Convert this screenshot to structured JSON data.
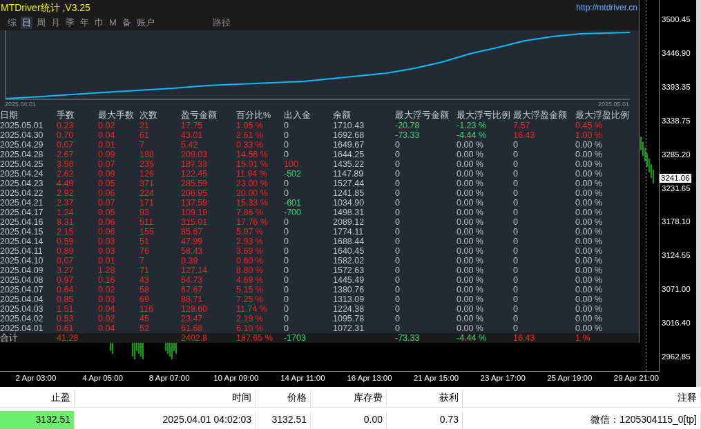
{
  "title": "MTDriver统计 ,V3.25",
  "url": "http://mtdriver.cn",
  "tabs": [
    {
      "label": "综",
      "selected": false
    },
    {
      "label": "日",
      "selected": true
    },
    {
      "label": "周",
      "selected": false
    },
    {
      "label": "月",
      "selected": false
    },
    {
      "label": "季",
      "selected": false
    },
    {
      "label": "年",
      "selected": false
    },
    {
      "label": "巾",
      "selected": false
    },
    {
      "label": "M",
      "selected": false
    },
    {
      "label": "备",
      "selected": false
    },
    {
      "label": "账户",
      "selected": false
    },
    {
      "label": "路径",
      "selected": false
    }
  ],
  "equity_chart": {
    "start_date": "2025.04.01",
    "end_date": "2025.05.01"
  },
  "stats_table": {
    "columns": [
      "日期",
      "手数",
      "最大手数",
      "次数",
      "盈亏金额",
      "百分比%",
      "出入金",
      "余额",
      "最大浮亏金额",
      "最大浮亏比例",
      "最大浮盈金额",
      "最大浮盈比例"
    ],
    "rows": [
      [
        {
          "text": "2025.05.01",
          "color": "#c0c4cc"
        },
        {
          "text": "0.23",
          "color": "#ff2020"
        },
        {
          "text": "0.02",
          "color": "#ff2020"
        },
        {
          "text": "21",
          "color": "#ff2020"
        },
        {
          "text": "17.75",
          "color": "#ff2020"
        },
        {
          "text": "1.05 %",
          "color": "#ff2020"
        },
        {
          "text": "0",
          "color": "#c0c4cc"
        },
        {
          "text": "1710.43",
          "color": "#c0c4cc"
        },
        {
          "text": "-20.78",
          "color": "#20e070"
        },
        {
          "text": "-1.23 %",
          "color": "#20e070"
        },
        {
          "text": "7.57",
          "color": "#ff2020"
        },
        {
          "text": "0.45 %",
          "color": "#ff2020"
        }
      ],
      [
        {
          "text": "2025.04.30",
          "color": "#c0c4cc"
        },
        {
          "text": "0.70",
          "color": "#ff2020"
        },
        {
          "text": "0.04",
          "color": "#ff2020"
        },
        {
          "text": "61",
          "color": "#ff2020"
        },
        {
          "text": "43.01",
          "color": "#ff2020"
        },
        {
          "text": "2.61 %",
          "color": "#ff2020"
        },
        {
          "text": "0",
          "color": "#c0c4cc"
        },
        {
          "text": "1692.68",
          "color": "#c0c4cc"
        },
        {
          "text": "-73.33",
          "color": "#20e070"
        },
        {
          "text": "-4.44 %",
          "color": "#20e070"
        },
        {
          "text": "16.43",
          "color": "#ff2020"
        },
        {
          "text": "1.00 %",
          "color": "#ff2020"
        }
      ],
      [
        {
          "text": "2025.04.29",
          "color": "#c0c4cc"
        },
        {
          "text": "0.07",
          "color": "#ff2020"
        },
        {
          "text": "0.01",
          "color": "#ff2020"
        },
        {
          "text": "7",
          "color": "#ff2020"
        },
        {
          "text": "5.42",
          "color": "#ff2020"
        },
        {
          "text": "0.33 %",
          "color": "#ff2020"
        },
        {
          "text": "0",
          "color": "#c0c4cc"
        },
        {
          "text": "1649.67",
          "color": "#c0c4cc"
        },
        {
          "text": "0",
          "color": "#c0c4cc"
        },
        {
          "text": "0.00 %",
          "color": "#c0c4cc"
        },
        {
          "text": "0",
          "color": "#c0c4cc"
        },
        {
          "text": "0.00 %",
          "color": "#c0c4cc"
        }
      ],
      [
        {
          "text": "2025.04.28",
          "color": "#c0c4cc"
        },
        {
          "text": "2.67",
          "color": "#ff2020"
        },
        {
          "text": "0.09",
          "color": "#ff2020"
        },
        {
          "text": "188",
          "color": "#ff2020"
        },
        {
          "text": "209.03",
          "color": "#ff2020"
        },
        {
          "text": "14.56 %",
          "color": "#ff2020"
        },
        {
          "text": "0",
          "color": "#c0c4cc"
        },
        {
          "text": "1644.25",
          "color": "#c0c4cc"
        },
        {
          "text": "0",
          "color": "#c0c4cc"
        },
        {
          "text": "0.00 %",
          "color": "#c0c4cc"
        },
        {
          "text": "0",
          "color": "#c0c4cc"
        },
        {
          "text": "0.00 %",
          "color": "#c0c4cc"
        }
      ],
      [
        {
          "text": "2025.04.25",
          "color": "#c0c4cc"
        },
        {
          "text": "3.58",
          "color": "#ff2020"
        },
        {
          "text": "0.07",
          "color": "#ff2020"
        },
        {
          "text": "235",
          "color": "#ff2020"
        },
        {
          "text": "187.33",
          "color": "#ff2020"
        },
        {
          "text": "15.01 %",
          "color": "#ff2020"
        },
        {
          "text": "100",
          "color": "#ff2020"
        },
        {
          "text": "1435.22",
          "color": "#c0c4cc"
        },
        {
          "text": "0",
          "color": "#c0c4cc"
        },
        {
          "text": "0.00 %",
          "color": "#c0c4cc"
        },
        {
          "text": "0",
          "color": "#c0c4cc"
        },
        {
          "text": "0.00 %",
          "color": "#c0c4cc"
        }
      ],
      [
        {
          "text": "2025.04.24",
          "color": "#c0c4cc"
        },
        {
          "text": "2.62",
          "color": "#ff2020"
        },
        {
          "text": "0.09",
          "color": "#ff2020"
        },
        {
          "text": "126",
          "color": "#ff2020"
        },
        {
          "text": "122.45",
          "color": "#ff2020"
        },
        {
          "text": "11.94 %",
          "color": "#ff2020"
        },
        {
          "text": "-502",
          "color": "#20e070"
        },
        {
          "text": "1147.89",
          "color": "#c0c4cc"
        },
        {
          "text": "0",
          "color": "#c0c4cc"
        },
        {
          "text": "0.00 %",
          "color": "#c0c4cc"
        },
        {
          "text": "0",
          "color": "#c0c4cc"
        },
        {
          "text": "0.00 %",
          "color": "#c0c4cc"
        }
      ],
      [
        {
          "text": "2025.04.23",
          "color": "#c0c4cc"
        },
        {
          "text": "4.49",
          "color": "#ff2020"
        },
        {
          "text": "0.05",
          "color": "#ff2020"
        },
        {
          "text": "371",
          "color": "#ff2020"
        },
        {
          "text": "285.59",
          "color": "#ff2020"
        },
        {
          "text": "23.00 %",
          "color": "#ff2020"
        },
        {
          "text": "0",
          "color": "#c0c4cc"
        },
        {
          "text": "1527.44",
          "color": "#c0c4cc"
        },
        {
          "text": "0",
          "color": "#c0c4cc"
        },
        {
          "text": "0.00 %",
          "color": "#c0c4cc"
        },
        {
          "text": "0",
          "color": "#c0c4cc"
        },
        {
          "text": "0.00 %",
          "color": "#c0c4cc"
        }
      ],
      [
        {
          "text": "2025.04.22",
          "color": "#c0c4cc"
        },
        {
          "text": "2.92",
          "color": "#ff2020"
        },
        {
          "text": "0.06",
          "color": "#ff2020"
        },
        {
          "text": "224",
          "color": "#ff2020"
        },
        {
          "text": "206.95",
          "color": "#ff2020"
        },
        {
          "text": "20.00 %",
          "color": "#ff2020"
        },
        {
          "text": "0",
          "color": "#c0c4cc"
        },
        {
          "text": "1241.85",
          "color": "#c0c4cc"
        },
        {
          "text": "0",
          "color": "#c0c4cc"
        },
        {
          "text": "0.00 %",
          "color": "#c0c4cc"
        },
        {
          "text": "0",
          "color": "#c0c4cc"
        },
        {
          "text": "0.00 %",
          "color": "#c0c4cc"
        }
      ],
      [
        {
          "text": "2025.04.21",
          "color": "#c0c4cc"
        },
        {
          "text": "2.37",
          "color": "#ff2020"
        },
        {
          "text": "0.07",
          "color": "#ff2020"
        },
        {
          "text": "171",
          "color": "#ff2020"
        },
        {
          "text": "137.59",
          "color": "#ff2020"
        },
        {
          "text": "15.33 %",
          "color": "#ff2020"
        },
        {
          "text": "-601",
          "color": "#20e070"
        },
        {
          "text": "1034.90",
          "color": "#c0c4cc"
        },
        {
          "text": "0",
          "color": "#c0c4cc"
        },
        {
          "text": "0.00 %",
          "color": "#c0c4cc"
        },
        {
          "text": "0",
          "color": "#c0c4cc"
        },
        {
          "text": "0.00 %",
          "color": "#c0c4cc"
        }
      ],
      [
        {
          "text": "2025.04.17",
          "color": "#c0c4cc"
        },
        {
          "text": "1.24",
          "color": "#ff2020"
        },
        {
          "text": "0.05",
          "color": "#ff2020"
        },
        {
          "text": "93",
          "color": "#ff2020"
        },
        {
          "text": "109.19",
          "color": "#ff2020"
        },
        {
          "text": "7.86 %",
          "color": "#ff2020"
        },
        {
          "text": "-700",
          "color": "#20e070"
        },
        {
          "text": "1498.31",
          "color": "#c0c4cc"
        },
        {
          "text": "0",
          "color": "#c0c4cc"
        },
        {
          "text": "0.00 %",
          "color": "#c0c4cc"
        },
        {
          "text": "0",
          "color": "#c0c4cc"
        },
        {
          "text": "0.00 %",
          "color": "#c0c4cc"
        }
      ],
      [
        {
          "text": "2025.04.16",
          "color": "#c0c4cc"
        },
        {
          "text": "8.31",
          "color": "#ff2020"
        },
        {
          "text": "0.06",
          "color": "#ff2020"
        },
        {
          "text": "511",
          "color": "#ff2020"
        },
        {
          "text": "315.01",
          "color": "#ff2020"
        },
        {
          "text": "17.76 %",
          "color": "#ff2020"
        },
        {
          "text": "0",
          "color": "#c0c4cc"
        },
        {
          "text": "2089.12",
          "color": "#c0c4cc"
        },
        {
          "text": "0",
          "color": "#c0c4cc"
        },
        {
          "text": "0.00 %",
          "color": "#c0c4cc"
        },
        {
          "text": "0",
          "color": "#c0c4cc"
        },
        {
          "text": "0.00 %",
          "color": "#c0c4cc"
        }
      ],
      [
        {
          "text": "2025.04.15",
          "color": "#c0c4cc"
        },
        {
          "text": "2.15",
          "color": "#ff2020"
        },
        {
          "text": "0.06",
          "color": "#ff2020"
        },
        {
          "text": "155",
          "color": "#ff2020"
        },
        {
          "text": "85.67",
          "color": "#ff2020"
        },
        {
          "text": "5.07 %",
          "color": "#ff2020"
        },
        {
          "text": "0",
          "color": "#c0c4cc"
        },
        {
          "text": "1774.11",
          "color": "#c0c4cc"
        },
        {
          "text": "0",
          "color": "#c0c4cc"
        },
        {
          "text": "0.00 %",
          "color": "#c0c4cc"
        },
        {
          "text": "0",
          "color": "#c0c4cc"
        },
        {
          "text": "0.00 %",
          "color": "#c0c4cc"
        }
      ],
      [
        {
          "text": "2025.04.14",
          "color": "#c0c4cc"
        },
        {
          "text": "0.59",
          "color": "#ff2020"
        },
        {
          "text": "0.03",
          "color": "#ff2020"
        },
        {
          "text": "51",
          "color": "#ff2020"
        },
        {
          "text": "47.99",
          "color": "#ff2020"
        },
        {
          "text": "2.93 %",
          "color": "#ff2020"
        },
        {
          "text": "0",
          "color": "#c0c4cc"
        },
        {
          "text": "1688.44",
          "color": "#c0c4cc"
        },
        {
          "text": "0",
          "color": "#c0c4cc"
        },
        {
          "text": "0.00 %",
          "color": "#c0c4cc"
        },
        {
          "text": "0",
          "color": "#c0c4cc"
        },
        {
          "text": "0.00 %",
          "color": "#c0c4cc"
        }
      ],
      [
        {
          "text": "2025.04.11",
          "color": "#c0c4cc"
        },
        {
          "text": "0.89",
          "color": "#ff2020"
        },
        {
          "text": "0.03",
          "color": "#ff2020"
        },
        {
          "text": "76",
          "color": "#ff2020"
        },
        {
          "text": "58.43",
          "color": "#ff2020"
        },
        {
          "text": "3.69 %",
          "color": "#ff2020"
        },
        {
          "text": "0",
          "color": "#c0c4cc"
        },
        {
          "text": "1640.45",
          "color": "#c0c4cc"
        },
        {
          "text": "0",
          "color": "#c0c4cc"
        },
        {
          "text": "0.00 %",
          "color": "#c0c4cc"
        },
        {
          "text": "0",
          "color": "#c0c4cc"
        },
        {
          "text": "0.00 %",
          "color": "#c0c4cc"
        }
      ],
      [
        {
          "text": "2025.04.10",
          "color": "#c0c4cc"
        },
        {
          "text": "0.07",
          "color": "#ff2020"
        },
        {
          "text": "0.01",
          "color": "#ff2020"
        },
        {
          "text": "7",
          "color": "#ff2020"
        },
        {
          "text": "9.39",
          "color": "#ff2020"
        },
        {
          "text": "0.60 %",
          "color": "#ff2020"
        },
        {
          "text": "0",
          "color": "#c0c4cc"
        },
        {
          "text": "1582.02",
          "color": "#c0c4cc"
        },
        {
          "text": "0",
          "color": "#c0c4cc"
        },
        {
          "text": "0.00 %",
          "color": "#c0c4cc"
        },
        {
          "text": "0",
          "color": "#c0c4cc"
        },
        {
          "text": "0.00 %",
          "color": "#c0c4cc"
        }
      ],
      [
        {
          "text": "2025.04.09",
          "color": "#c0c4cc"
        },
        {
          "text": "3.27",
          "color": "#ff2020"
        },
        {
          "text": "1.28",
          "color": "#ff2020"
        },
        {
          "text": "71",
          "color": "#ff2020"
        },
        {
          "text": "127.14",
          "color": "#ff2020"
        },
        {
          "text": "8.80 %",
          "color": "#ff2020"
        },
        {
          "text": "0",
          "color": "#c0c4cc"
        },
        {
          "text": "1572.63",
          "color": "#c0c4cc"
        },
        {
          "text": "0",
          "color": "#c0c4cc"
        },
        {
          "text": "0.00 %",
          "color": "#c0c4cc"
        },
        {
          "text": "0",
          "color": "#c0c4cc"
        },
        {
          "text": "0.00 %",
          "color": "#c0c4cc"
        }
      ],
      [
        {
          "text": "2025.04.08",
          "color": "#c0c4cc"
        },
        {
          "text": "0.97",
          "color": "#ff2020"
        },
        {
          "text": "0.16",
          "color": "#ff2020"
        },
        {
          "text": "43",
          "color": "#ff2020"
        },
        {
          "text": "64.73",
          "color": "#ff2020"
        },
        {
          "text": "4.69 %",
          "color": "#ff2020"
        },
        {
          "text": "0",
          "color": "#c0c4cc"
        },
        {
          "text": "1445.49",
          "color": "#c0c4cc"
        },
        {
          "text": "0",
          "color": "#c0c4cc"
        },
        {
          "text": "0.00 %",
          "color": "#c0c4cc"
        },
        {
          "text": "0",
          "color": "#c0c4cc"
        },
        {
          "text": "0.00 %",
          "color": "#c0c4cc"
        }
      ],
      [
        {
          "text": "2025.04.07",
          "color": "#c0c4cc"
        },
        {
          "text": "0.64",
          "color": "#ff2020"
        },
        {
          "text": "0.02",
          "color": "#ff2020"
        },
        {
          "text": "58",
          "color": "#ff2020"
        },
        {
          "text": "67.67",
          "color": "#ff2020"
        },
        {
          "text": "5.15 %",
          "color": "#ff2020"
        },
        {
          "text": "0",
          "color": "#c0c4cc"
        },
        {
          "text": "1380.76",
          "color": "#c0c4cc"
        },
        {
          "text": "0",
          "color": "#c0c4cc"
        },
        {
          "text": "0.00 %",
          "color": "#c0c4cc"
        },
        {
          "text": "0",
          "color": "#c0c4cc"
        },
        {
          "text": "0.00 %",
          "color": "#c0c4cc"
        }
      ],
      [
        {
          "text": "2025.04.04",
          "color": "#c0c4cc"
        },
        {
          "text": "0.85",
          "color": "#ff2020"
        },
        {
          "text": "0.03",
          "color": "#ff2020"
        },
        {
          "text": "69",
          "color": "#ff2020"
        },
        {
          "text": "88.71",
          "color": "#ff2020"
        },
        {
          "text": "7.25 %",
          "color": "#ff2020"
        },
        {
          "text": "0",
          "color": "#c0c4cc"
        },
        {
          "text": "1313.09",
          "color": "#c0c4cc"
        },
        {
          "text": "0",
          "color": "#c0c4cc"
        },
        {
          "text": "0.00 %",
          "color": "#c0c4cc"
        },
        {
          "text": "0",
          "color": "#c0c4cc"
        },
        {
          "text": "0.00 %",
          "color": "#c0c4cc"
        }
      ],
      [
        {
          "text": "2025.04.03",
          "color": "#c0c4cc"
        },
        {
          "text": "1.51",
          "color": "#ff2020"
        },
        {
          "text": "0.04",
          "color": "#ff2020"
        },
        {
          "text": "116",
          "color": "#ff2020"
        },
        {
          "text": "128.60",
          "color": "#ff2020"
        },
        {
          "text": "11.74 %",
          "color": "#ff2020"
        },
        {
          "text": "0",
          "color": "#c0c4cc"
        },
        {
          "text": "1224.38",
          "color": "#c0c4cc"
        },
        {
          "text": "0",
          "color": "#c0c4cc"
        },
        {
          "text": "0.00 %",
          "color": "#c0c4cc"
        },
        {
          "text": "0",
          "color": "#c0c4cc"
        },
        {
          "text": "0.00 %",
          "color": "#c0c4cc"
        }
      ],
      [
        {
          "text": "2025.04.02",
          "color": "#c0c4cc"
        },
        {
          "text": "0.53",
          "color": "#ff2020"
        },
        {
          "text": "0.02",
          "color": "#ff2020"
        },
        {
          "text": "45",
          "color": "#ff2020"
        },
        {
          "text": "23.47",
          "color": "#ff2020"
        },
        {
          "text": "2.19 %",
          "color": "#ff2020"
        },
        {
          "text": "0",
          "color": "#c0c4cc"
        },
        {
          "text": "1095.78",
          "color": "#c0c4cc"
        },
        {
          "text": "0",
          "color": "#c0c4cc"
        },
        {
          "text": "0.00 %",
          "color": "#c0c4cc"
        },
        {
          "text": "0",
          "color": "#c0c4cc"
        },
        {
          "text": "0.00 %",
          "color": "#c0c4cc"
        }
      ],
      [
        {
          "text": "2025.04.01",
          "color": "#c0c4cc"
        },
        {
          "text": "0.61",
          "color": "#ff2020"
        },
        {
          "text": "0.04",
          "color": "#ff2020"
        },
        {
          "text": "52",
          "color": "#ff2020"
        },
        {
          "text": "61.68",
          "color": "#ff2020"
        },
        {
          "text": "6.10 %",
          "color": "#ff2020"
        },
        {
          "text": "0",
          "color": "#c0c4cc"
        },
        {
          "text": "1072.31",
          "color": "#c0c4cc"
        },
        {
          "text": "0",
          "color": "#c0c4cc"
        },
        {
          "text": "0.00 %",
          "color": "#c0c4cc"
        },
        {
          "text": "0",
          "color": "#c0c4cc"
        },
        {
          "text": "0.00 %",
          "color": "#c0c4cc"
        }
      ]
    ],
    "total_row": {
      "label": {
        "text": "合计",
        "color": "#c0c4cc"
      },
      "lots": {
        "text": "41.28",
        "color": "#ff2020"
      },
      "profit": {
        "text": "2402.8",
        "color": "#ff2020"
      },
      "percent": {
        "text": "187.65 %",
        "color": "#ff2020"
      },
      "deposit": {
        "text": "-1703",
        "color": "#20e070"
      },
      "max_float_loss": {
        "text": "-73.33",
        "color": "#20e070"
      },
      "max_float_loss_pct": {
        "text": "-4.44 %",
        "color": "#20e070"
      },
      "max_float_profit": {
        "text": "16.43",
        "color": "#ff2020"
      },
      "max_float_profit_pct": {
        "text": "1 %",
        "color": "#ff2020"
      }
    }
  },
  "price_axis": {
    "labels": [
      "3500.45",
      "3446.90",
      "3393.35",
      "3338.75",
      "3285.20",
      "3231.65",
      "3178.10",
      "3124.55",
      "3071.00",
      "3016.40",
      "2962.85"
    ],
    "current_price": "3241.06"
  },
  "time_axis": {
    "labels": [
      "2 Apr 03:00",
      "4 Apr 05:00",
      "8 Apr 07:00",
      "10 Apr 09:00",
      "14 Apr 11:00",
      "16 Apr 13:00",
      "21 Apr 15:00",
      "23 Apr 17:00",
      "25 Apr 19:00",
      "29 Apr 21:00"
    ]
  },
  "trade_table": {
    "columns": [
      "止盈",
      "时间",
      "价格",
      "库存费",
      "获利",
      "注释"
    ],
    "row": [
      "3132.51",
      "2025.04.01 04:02:03",
      "3132.51",
      "0.00",
      "0.73",
      "微信：1205304115_0[tp]"
    ]
  }
}
